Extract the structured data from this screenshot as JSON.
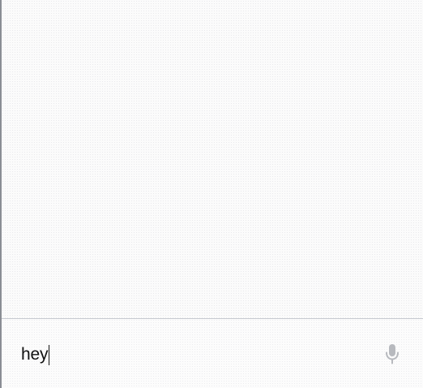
{
  "composer": {
    "message_text": "hey",
    "mic_icon": "microphone-icon"
  },
  "colors": {
    "border": "#8a8d94",
    "divider": "#c7cad0",
    "icon": "#b7b9be",
    "text": "#111111"
  }
}
